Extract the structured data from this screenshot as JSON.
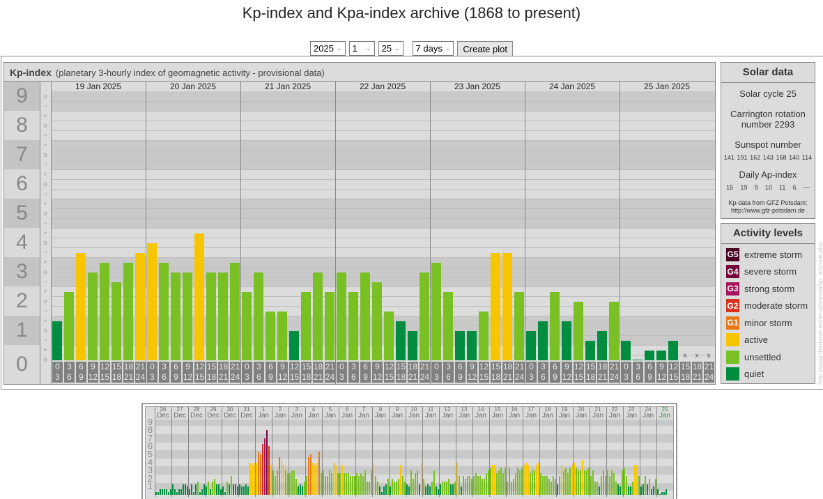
{
  "title": "Kp-index and Kpa-index archive (1868 to present)",
  "controls": {
    "year": "2025",
    "month": "1",
    "day": "25",
    "range": "7 days",
    "create_label": "Create plot"
  },
  "kp_panel": {
    "title": "Kp-index",
    "subtitle": "(planetary 3-hourly index of geomagnetic activity - provisional data)"
  },
  "solar": {
    "title": "Solar data",
    "cycle": "Solar cycle 25",
    "carrington_1": "Carrington rotation",
    "carrington_2": "number 2293",
    "sunspot_label": "Sunspot number",
    "sunspots": [
      "141",
      "191",
      "162",
      "143",
      "168",
      "140",
      "114"
    ],
    "ap_label": "Daily Ap-index",
    "ap": [
      "15",
      "19",
      "9",
      "10",
      "11",
      "6",
      "---"
    ],
    "source_1": "Kp-data from GFZ Potsdam:",
    "source_2": "http://www.gfz-potsdam.de"
  },
  "activity": {
    "title": "Activity levels",
    "levels": [
      {
        "badge": "G5",
        "label": "extreme storm",
        "color": "#4a0020"
      },
      {
        "badge": "G4",
        "label": "severe storm",
        "color": "#75073a"
      },
      {
        "badge": "G3",
        "label": "strong storm",
        "color": "#a8145e"
      },
      {
        "badge": "G2",
        "label": "moderate storm",
        "color": "#d8321c"
      },
      {
        "badge": "G1",
        "label": "minor storm",
        "color": "#e67818"
      },
      {
        "badge": "",
        "label": "active",
        "color": "#f8c600"
      },
      {
        "badge": "",
        "label": "unsettled",
        "color": "#79c023"
      },
      {
        "badge": "",
        "label": "quiet",
        "color": "#008d3f"
      }
    ]
  },
  "watermark": "http://www.theusner.eu/terra/aurora/kp_archive.php",
  "chart_data": [
    {
      "type": "bar",
      "title": "Kp-index",
      "ylabel": "Kp",
      "ylim": [
        0,
        9
      ],
      "y_ticks": [
        "0",
        "1",
        "2",
        "3",
        "4",
        "5",
        "6",
        "7",
        "8",
        "9"
      ],
      "minor_marks": [
        "+",
        "o",
        "−"
      ],
      "days": [
        "19 Jan 2025",
        "20 Jan 2025",
        "21 Jan 2025",
        "22 Jan 2025",
        "23 Jan 2025",
        "24 Jan 2025",
        "25 Jan 2025"
      ],
      "slots": [
        [
          "0",
          "3"
        ],
        [
          "3",
          "6"
        ],
        [
          "6",
          "9"
        ],
        [
          "9",
          "12"
        ],
        [
          "12",
          "15"
        ],
        [
          "15",
          "18"
        ],
        [
          "18",
          "21"
        ],
        [
          "21",
          "24"
        ]
      ],
      "missing_mark": "x",
      "values": [
        [
          "1+",
          "2+",
          "4-",
          "3o",
          "3+",
          "3-",
          "3+",
          "4-"
        ],
        [
          "4o",
          "3+",
          "3o",
          "3o",
          "4+",
          "3o",
          "3o",
          "3+"
        ],
        [
          "2+",
          "3o",
          "2-",
          "2-",
          "1o",
          "2+",
          "3o",
          "2+"
        ],
        [
          "3o",
          "2+",
          "3o",
          "3-",
          "2-",
          "1+",
          "1o",
          "3o"
        ],
        [
          "3+",
          "2+",
          "1o",
          "1o",
          "2-",
          "4-",
          "4-",
          "2+"
        ],
        [
          "1o",
          "1+",
          "2+",
          "1+",
          "2o",
          "1-",
          "1o",
          "2o"
        ],
        [
          "1-",
          "0o",
          "0+",
          "0+",
          "1-",
          null,
          null,
          null
        ]
      ]
    },
    {
      "type": "bar",
      "title": "Kp-index last 31 days",
      "ylim": [
        0,
        9
      ],
      "y_ticks": [
        "1",
        "2",
        "3",
        "4",
        "5",
        "6",
        "7",
        "8",
        "9"
      ],
      "days": [
        [
          "26",
          "Dec"
        ],
        [
          "27",
          "Dec"
        ],
        [
          "28",
          "Dec"
        ],
        [
          "29",
          "Dec"
        ],
        [
          "30",
          "Dec"
        ],
        [
          "31",
          "Dec"
        ],
        [
          "1",
          "Jan"
        ],
        [
          "2",
          "Jan"
        ],
        [
          "3",
          "Jan"
        ],
        [
          "4",
          "Jan"
        ],
        [
          "5",
          "Jan"
        ],
        [
          "6",
          "Jan"
        ],
        [
          "7",
          "Jan"
        ],
        [
          "8",
          "Jan"
        ],
        [
          "9",
          "Jan"
        ],
        [
          "10",
          "Jan"
        ],
        [
          "11",
          "Jan"
        ],
        [
          "12",
          "Jan"
        ],
        [
          "13",
          "Jan"
        ],
        [
          "14",
          "Jan"
        ],
        [
          "15",
          "Jan"
        ],
        [
          "16",
          "Jan"
        ],
        [
          "17",
          "Jan"
        ],
        [
          "18",
          "Jan"
        ],
        [
          "19",
          "Jan"
        ],
        [
          "20",
          "Jan"
        ],
        [
          "21",
          "Jan"
        ],
        [
          "22",
          "Jan"
        ],
        [
          "23",
          "Jan"
        ],
        [
          "24",
          "Jan"
        ],
        [
          "25",
          "Jan"
        ]
      ],
      "current_day_color": "#2a9a4a",
      "values": [
        [
          "0+",
          "0+",
          "1-",
          "1-",
          "1-",
          "1-",
          "0+",
          "1-"
        ],
        [
          "1+",
          "1-",
          "0+",
          "1-",
          "1-",
          "1+",
          "1+",
          "1o"
        ],
        [
          "1-",
          "1+",
          "0+",
          "1+",
          "2-",
          "0+",
          "1-",
          "1+"
        ],
        [
          "1o",
          "2-",
          "1-",
          "2-",
          "2o",
          "1+",
          "1+",
          "1-"
        ],
        [
          "1o",
          "0+",
          "2-",
          "1+",
          "2+",
          "1+",
          "1+",
          "1o"
        ],
        [
          "1+",
          "1o",
          "1o",
          "1+",
          "1o",
          "4o",
          "4-",
          "4o"
        ],
        [
          "4o",
          "5+",
          "5o",
          "6+",
          "7o",
          "8o",
          "6o",
          "4-"
        ],
        [
          "3o",
          "2+",
          "3o",
          "5-",
          "4+",
          "4-",
          "3o",
          "3-"
        ],
        [
          "3-",
          "3o",
          "3o",
          "2o",
          "1o",
          "1+",
          "1o",
          "2-"
        ],
        [
          "2+",
          "5-",
          "5o",
          "4o",
          "4-",
          "4o",
          "5+",
          "3-"
        ],
        [
          "3o",
          "2+",
          "2+",
          "3o",
          "3-",
          "4o",
          "4-",
          "3-"
        ],
        [
          "3-",
          "4-",
          "3-",
          "3-",
          "3-",
          "2+",
          "2+",
          "2+"
        ],
        [
          "3-",
          "2+",
          "3-",
          "2+",
          "3o",
          "2-",
          "2-",
          "3o"
        ],
        [
          "4-",
          "2+",
          "2-",
          "1o",
          "0+",
          "1o",
          "1+",
          "2o"
        ],
        [
          "1o",
          "2o",
          "2-",
          "2-",
          "2o",
          "4-",
          "2+",
          "2-"
        ],
        [
          "1+",
          "1o",
          "3o",
          "2o",
          "3-",
          "3o",
          "1+",
          "4o"
        ],
        [
          "2o",
          "1o",
          "1+",
          "1o",
          "2-",
          "3o",
          "1o",
          "1-"
        ],
        [
          "1+",
          "2-",
          "2-",
          "2-",
          "2o",
          "1+",
          "1+",
          "2-"
        ],
        [
          "4o",
          "2+",
          "1o",
          "2+",
          "2o",
          "2+",
          "2+",
          "2o"
        ],
        [
          "2+",
          "3-",
          "2+",
          "2+",
          "2o",
          "2o",
          "3-",
          "3o"
        ],
        [
          "3+",
          "4-",
          "4-",
          "3-",
          "3o",
          "3+",
          "3-",
          "3+"
        ],
        [
          "2-",
          "3+",
          "2-",
          "2o",
          "3-",
          "3+",
          "3o",
          "3+"
        ],
        [
          "4-",
          "4o",
          "4-",
          "3-",
          "3o",
          "3o",
          "4-",
          "4o"
        ],
        [
          "3-",
          "2+",
          "2+",
          "2+",
          "2o",
          "2-",
          "2+",
          "2o"
        ],
        [
          "1+",
          "2+",
          "4-",
          "3o",
          "3+",
          "3-",
          "3+",
          "4-"
        ],
        [
          "4o",
          "3+",
          "3o",
          "3o",
          "4+",
          "3o",
          "3o",
          "3+"
        ],
        [
          "2+",
          "3o",
          "2-",
          "2-",
          "1o",
          "2+",
          "3o",
          "2+"
        ],
        [
          "3o",
          "2+",
          "3o",
          "3-",
          "2-",
          "1+",
          "1o",
          "3o"
        ],
        [
          "3+",
          "2+",
          "1o",
          "1o",
          "2-",
          "4-",
          "4-",
          "2+"
        ],
        [
          "1o",
          "1+",
          "2+",
          "1+",
          "2o",
          "1-",
          "1o",
          "2o"
        ],
        [
          "1-",
          "0o",
          "0+",
          "0+",
          "1-",
          null,
          null,
          null
        ]
      ]
    }
  ]
}
